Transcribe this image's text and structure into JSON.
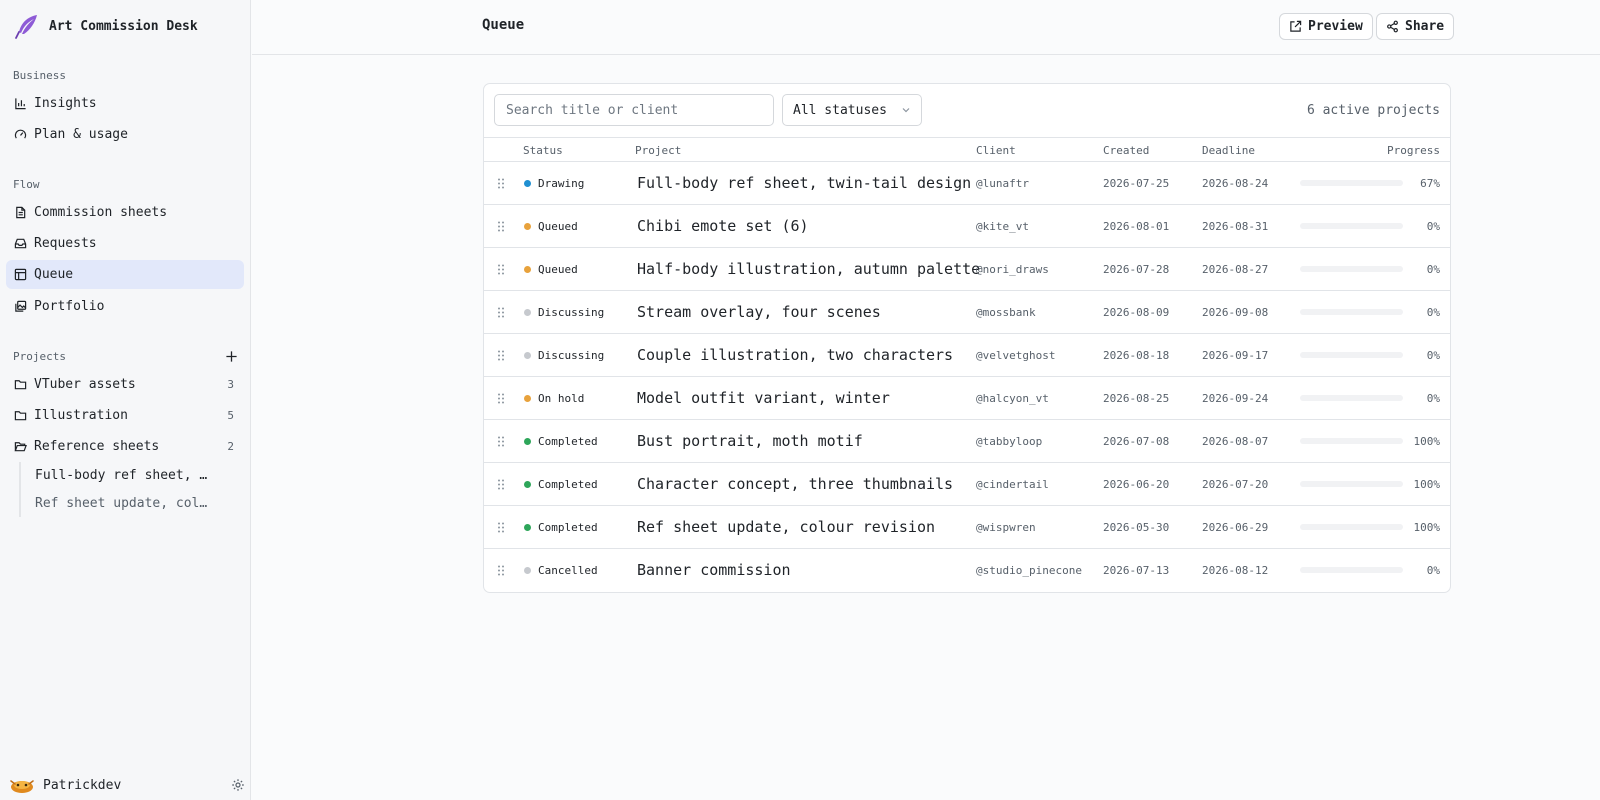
{
  "app": {
    "title": "Art Commission Desk"
  },
  "sidebar": {
    "sections": [
      {
        "title": "Business",
        "items": [
          {
            "label": "Insights",
            "icon": "bar-chart-icon"
          },
          {
            "label": "Plan & usage",
            "icon": "gauge-icon"
          }
        ]
      },
      {
        "title": "Flow",
        "items": [
          {
            "label": "Commission sheets",
            "icon": "file-text-icon"
          },
          {
            "label": "Requests",
            "icon": "inbox-icon"
          },
          {
            "label": "Queue",
            "icon": "table-icon",
            "active": true
          },
          {
            "label": "Portfolio",
            "icon": "gallery-icon"
          }
        ]
      }
    ],
    "projects": {
      "title": "Projects",
      "items": [
        {
          "label": "VTuber assets",
          "count": "3",
          "icon": "folder-icon"
        },
        {
          "label": "Illustration",
          "count": "5",
          "icon": "folder-icon"
        },
        {
          "label": "Reference sheets",
          "count": "2",
          "icon": "folder-open-icon"
        }
      ],
      "subitems": [
        "Full-body ref sheet, twin-tail design",
        "Ref sheet update, colour revision"
      ]
    },
    "user": {
      "name": "Patrickdev"
    }
  },
  "header": {
    "title": "Queue",
    "preview_label": "Preview",
    "share_label": "Share"
  },
  "toolbar": {
    "search_placeholder": "Search title or client",
    "status_filter": "All statuses",
    "count_text": "6 active projects"
  },
  "table": {
    "columns": [
      "Status",
      "Project",
      "Client",
      "Created",
      "Deadline",
      "Progress"
    ],
    "rows": [
      {
        "status": "Drawing",
        "color": "#1f8fd1",
        "project": "Full-body ref sheet, twin-tail design",
        "client": "@lunaftr",
        "created": "2026-07-25",
        "deadline": "2026-08-24",
        "progress": 67,
        "progress_label": "67%"
      },
      {
        "status": "Queued",
        "color": "#e8a23c",
        "project": "Chibi emote set (6)",
        "client": "@kite_vt",
        "created": "2026-08-01",
        "deadline": "2026-08-31",
        "progress": 0,
        "progress_label": "0%"
      },
      {
        "status": "Queued",
        "color": "#e8a23c",
        "project": "Half-body illustration, autumn palette",
        "client": "@nori_draws",
        "created": "2026-07-28",
        "deadline": "2026-08-27",
        "progress": 0,
        "progress_label": "0%"
      },
      {
        "status": "Discussing",
        "color": "#c6c9ce",
        "project": "Stream overlay, four scenes",
        "client": "@mossbank",
        "created": "2026-08-09",
        "deadline": "2026-09-08",
        "progress": 0,
        "progress_label": "0%"
      },
      {
        "status": "Discussing",
        "color": "#c6c9ce",
        "project": "Couple illustration, two characters",
        "client": "@velvetghost",
        "created": "2026-08-18",
        "deadline": "2026-09-17",
        "progress": 0,
        "progress_label": "0%"
      },
      {
        "status": "On hold",
        "color": "#e8a23c",
        "project": "Model outfit variant, winter",
        "client": "@halcyon_vt",
        "created": "2026-08-25",
        "deadline": "2026-09-24",
        "progress": 0,
        "progress_label": "0%"
      },
      {
        "status": "Completed",
        "color": "#2ea65a",
        "project": "Bust portrait, moth motif",
        "client": "@tabbyloop",
        "created": "2026-07-08",
        "deadline": "2026-08-07",
        "progress": 100,
        "progress_label": "100%"
      },
      {
        "status": "Completed",
        "color": "#2ea65a",
        "project": "Character concept, three thumbnails",
        "client": "@cindertail",
        "created": "2026-06-20",
        "deadline": "2026-07-20",
        "progress": 100,
        "progress_label": "100%"
      },
      {
        "status": "Completed",
        "color": "#2ea65a",
        "project": "Ref sheet update, colour revision",
        "client": "@wispwren",
        "created": "2026-05-30",
        "deadline": "2026-06-29",
        "progress": 100,
        "progress_label": "100%"
      },
      {
        "status": "Cancelled",
        "color": "#c6c9ce",
        "project": "Banner commission",
        "client": "@studio_pinecone",
        "created": "2026-07-13",
        "deadline": "2026-08-12",
        "progress": 0,
        "progress_label": "0%"
      }
    ]
  },
  "colors": {
    "accent": "#e2e8fa",
    "progress_partial": "#e8a23c",
    "progress_complete": "#5257d9"
  }
}
